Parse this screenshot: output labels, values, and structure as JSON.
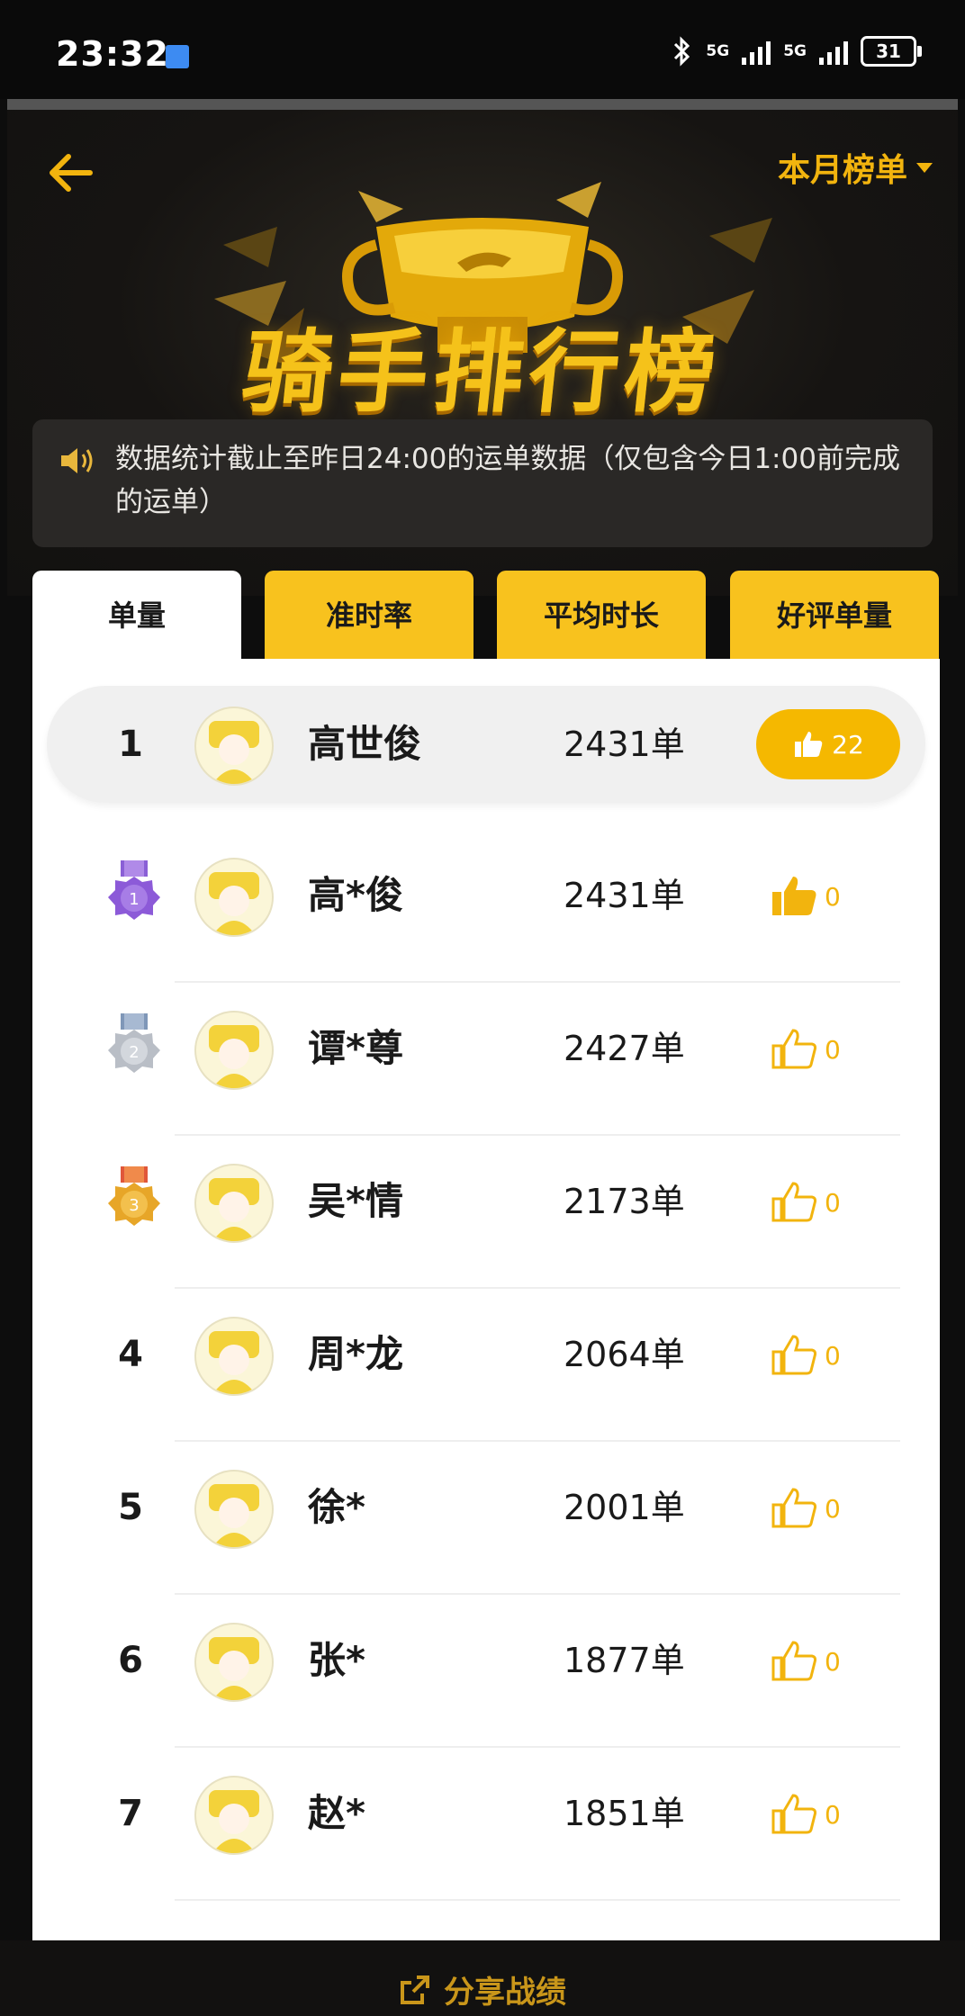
{
  "status_bar": {
    "time": "23:32",
    "network1": "5G",
    "network2": "5G",
    "battery": "31"
  },
  "header": {
    "back_icon": "arrow-left-icon",
    "period_selector": "本月榜单",
    "title": "骑手排行榜",
    "notice": "数据统计截止至昨日24:00的运单数据（仅包含今日1:00前完成的运单）"
  },
  "tabs": [
    {
      "label": "单量",
      "active": true
    },
    {
      "label": "准时率",
      "active": false
    },
    {
      "label": "平均时长",
      "active": false
    },
    {
      "label": "好评单量",
      "active": false
    }
  ],
  "my_rank": {
    "rank": "1",
    "name": "高世俊",
    "orders": "2431单",
    "likes": "22"
  },
  "rows": [
    {
      "rank": "1",
      "medal": "purple",
      "name": "高*俊",
      "orders": "2431单",
      "likes": "0",
      "liked": true
    },
    {
      "rank": "2",
      "medal": "silver",
      "name": "谭*尊",
      "orders": "2427单",
      "likes": "0",
      "liked": false
    },
    {
      "rank": "3",
      "medal": "gold",
      "name": "吴*情",
      "orders": "2173单",
      "likes": "0",
      "liked": false
    },
    {
      "rank": "4",
      "name": "周*龙",
      "orders": "2064单",
      "likes": "0",
      "liked": false
    },
    {
      "rank": "5",
      "name": "徐*",
      "orders": "2001单",
      "likes": "0",
      "liked": false
    },
    {
      "rank": "6",
      "name": "张*",
      "orders": "1877单",
      "likes": "0",
      "liked": false
    },
    {
      "rank": "7",
      "name": "赵*",
      "orders": "1851单",
      "likes": "0",
      "liked": false
    }
  ],
  "bottom": {
    "share_label": "分享战绩"
  },
  "colors": {
    "accent": "#f5b800",
    "dark": "#121110"
  }
}
